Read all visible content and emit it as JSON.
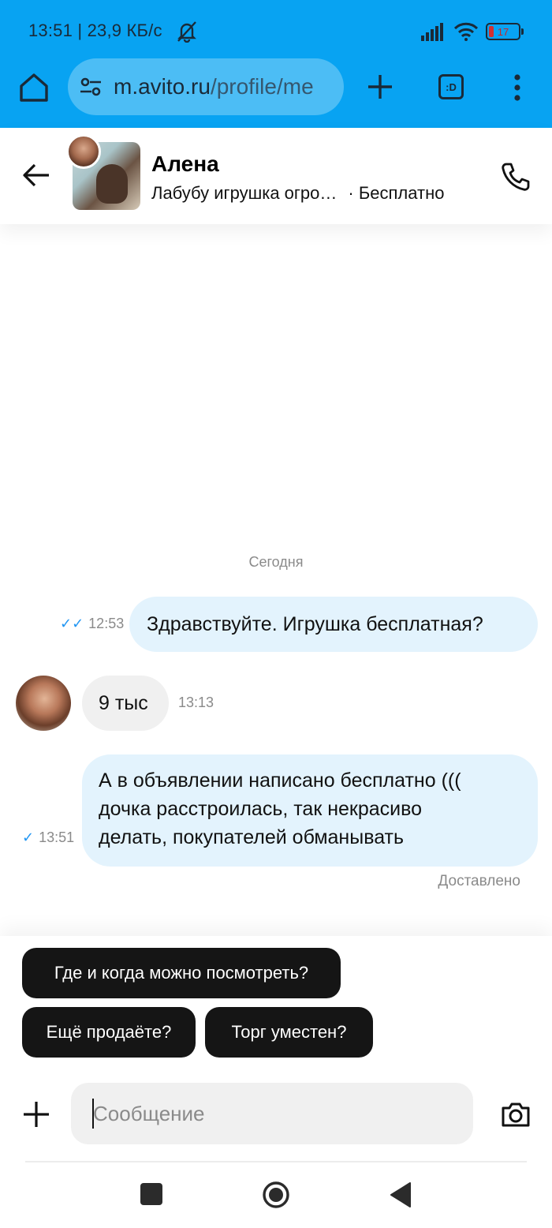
{
  "status_bar": {
    "time_info": "13:51 | 23,9 КБ/с",
    "battery": "17",
    "icons": [
      "bell-off-icon",
      "signal-icon",
      "wifi-icon",
      "battery-icon"
    ]
  },
  "browser": {
    "url_host": "m.avito.ru",
    "url_path": "/profile/me",
    "tabs_label": ":D",
    "icons": [
      "home-icon",
      "tune-icon",
      "plus-icon",
      "tabs-icon",
      "more-vert-icon"
    ]
  },
  "chat_header": {
    "seller_name": "Алена",
    "item_title": "Лабубу игрушка огро…",
    "item_price": "· Бесплатно",
    "icons": [
      "back-arrow-icon",
      "phone-icon"
    ]
  },
  "chat": {
    "day_label": "Сегодня",
    "messages": [
      {
        "direction": "out",
        "text": "Здравствуйте. Игрушка бесплатная?",
        "time": "12:53",
        "status": "read"
      },
      {
        "direction": "in",
        "text": "9 тыс",
        "time": "13:13"
      },
      {
        "direction": "out",
        "text": "А в объявлении написано бесплатно (((\nдочка расстроилась, так некрасиво\nделать, покупателей обманывать",
        "time": "13:51",
        "status": "sent"
      }
    ],
    "delivered_label": "Доставлено"
  },
  "quick_replies": [
    "Где и когда можно посмотреть?",
    "Ещё продаёте?",
    "Торг уместен?"
  ],
  "composer": {
    "placeholder": "Сообщение",
    "value": "",
    "icons": [
      "plus-icon",
      "camera-icon"
    ]
  },
  "colors": {
    "browser_bar": "#08a3f2",
    "url_pill": "#4cbdf5",
    "bubble_out": "#e3f3fd",
    "bubble_in": "#f0f0f0",
    "chip": "#151515",
    "check": "#2196f3"
  }
}
